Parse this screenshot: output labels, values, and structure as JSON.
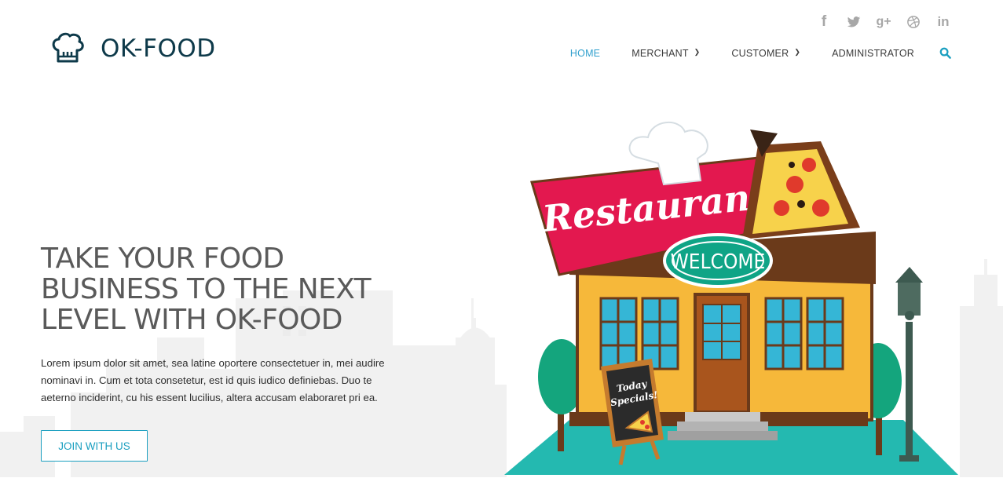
{
  "brand": {
    "name": "OK-FOOD",
    "logo_icon": "chef-hat-icon"
  },
  "social": [
    {
      "name": "facebook-icon",
      "glyph": "f"
    },
    {
      "name": "twitter-icon",
      "glyph": ""
    },
    {
      "name": "google-plus-icon",
      "glyph": "g+"
    },
    {
      "name": "dribbble-icon",
      "glyph": ""
    },
    {
      "name": "linkedin-icon",
      "glyph": "in"
    }
  ],
  "nav": {
    "home": "HOME",
    "merchant": "MERCHANT",
    "customer": "CUSTOMER",
    "administrator": "ADMINISTRATOR",
    "active_color": "#2f9fcd"
  },
  "hero": {
    "title": "TAKE YOUR FOOD BUSINESS TO THE NEXT LEVEL WITH OK-FOOD",
    "body": "Lorem ipsum dolor sit amet, sea latine oportere consectetuer in, mei audire nominavi in. Cum et tota consetetur, est id quis iudico definiebas. Duo te aeterno inciderint, cu his essent lucilius, altera accusam elaboraret pri ea.",
    "cta": "JOIN WITH US"
  },
  "illustration": {
    "sign": "Restaurant",
    "welcome": "WELCOME",
    "board_line1": "Today",
    "board_line2": "Specials!"
  },
  "colors": {
    "brand_dark": "#0e3a4a",
    "accent": "#1b9fc0",
    "sign_red": "#e3184f",
    "building_yellow": "#f6b83a",
    "window_blue": "#35b6d6",
    "tree_green": "#14a57d"
  }
}
